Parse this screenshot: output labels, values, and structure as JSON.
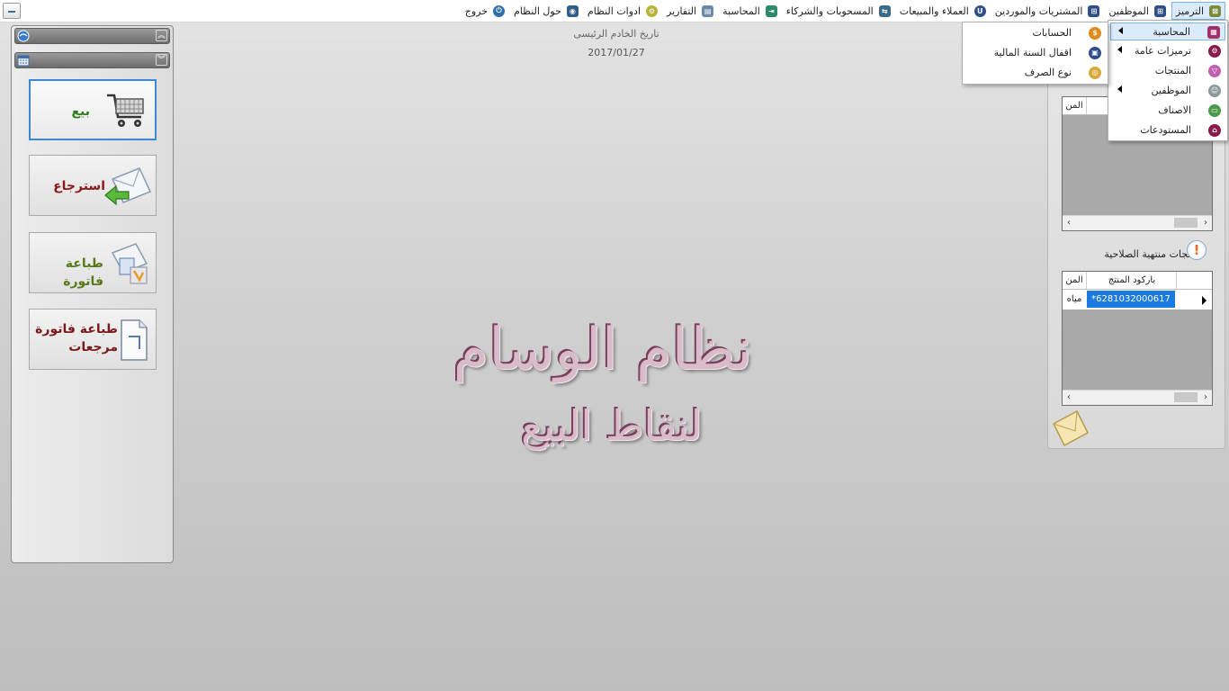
{
  "menubar": {
    "items": [
      {
        "label": "الترميز",
        "icon": "coding-icon",
        "color": "#7a8a3a",
        "active": true
      },
      {
        "label": "الموظفين",
        "icon": "employees-icon",
        "color": "#2f4f8a"
      },
      {
        "label": "المشتريات والموردين",
        "icon": "purchases-icon",
        "color": "#2f4f8a"
      },
      {
        "label": "العملاء والمبيعات",
        "icon": "customers-icon",
        "color": "#2f4f8a"
      },
      {
        "label": "المسحوبات والشركاء",
        "icon": "withdrawals-icon",
        "color": "#3a6a8a"
      },
      {
        "label": "المحاسبة",
        "icon": "accounting-icon",
        "color": "#2a8a6a"
      },
      {
        "label": "التقارير",
        "icon": "reports-icon",
        "color": "#6a8aa8"
      },
      {
        "label": "ادوات النظام",
        "icon": "tools-icon",
        "color": "#b8b43a"
      },
      {
        "label": "حول النظام",
        "icon": "about-icon",
        "color": "#2f5f8a"
      },
      {
        "label": "خروج",
        "icon": "exit-icon",
        "color": "#2f6fb0"
      }
    ]
  },
  "center": {
    "server_date_label": "تاريخ الخادم الرئيسى",
    "server_date": "2017/01/27",
    "logo_main": "نظام الوسام",
    "logo_sub": "لنقاط البيع"
  },
  "left_panel": {
    "buttons": [
      {
        "label": "بيع",
        "color": "#2e7d1e"
      },
      {
        "label": "استرجاع",
        "color": "#8b1a1a"
      },
      {
        "label": "طباعة فاتورة",
        "color": "#5a7a1a"
      },
      {
        "label_line1": "طباعة فاتورة",
        "label_line2": "مرجعات",
        "color": "#7a1a1a"
      }
    ]
  },
  "right_panel": {
    "grid1": {
      "headers": [
        "",
        "المن"
      ]
    },
    "expired_title": "منتجات منتهية الصلاحية",
    "grid2": {
      "headers": [
        "باركود المنتج",
        "المن"
      ],
      "rows": [
        {
          "barcode": "*6281032000617",
          "product": "مياه"
        }
      ]
    }
  },
  "dropdown_main": {
    "items": [
      {
        "label": "المحاسبة",
        "icon": "accounting-icon",
        "color": "#a0306a",
        "submenu": true,
        "active": true
      },
      {
        "label": "ترميزات عامة",
        "icon": "general-codes-icon",
        "color": "#8a1a4a",
        "submenu": true
      },
      {
        "label": "المنتجات",
        "icon": "products-icon",
        "color": "#c060b0",
        "submenu": false
      },
      {
        "label": "الموظفين",
        "icon": "employees-icon",
        "color": "#8a9a9a",
        "submenu": true
      },
      {
        "label": "الاصناف",
        "icon": "categories-icon",
        "color": "#4a9a4a",
        "submenu": false
      },
      {
        "label": "المستودعات",
        "icon": "warehouses-icon",
        "color": "#8a1a4a",
        "submenu": false
      }
    ]
  },
  "dropdown_sub": {
    "items": [
      {
        "label": "الحسابات",
        "icon": "accounts-icon",
        "color": "#e08a1a"
      },
      {
        "label": "اقفال السنة المالية",
        "icon": "fiscal-close-icon",
        "color": "#2f4f8a"
      },
      {
        "label": "نوع الصرف",
        "icon": "exchange-type-icon",
        "color": "#d8a83a"
      }
    ]
  }
}
